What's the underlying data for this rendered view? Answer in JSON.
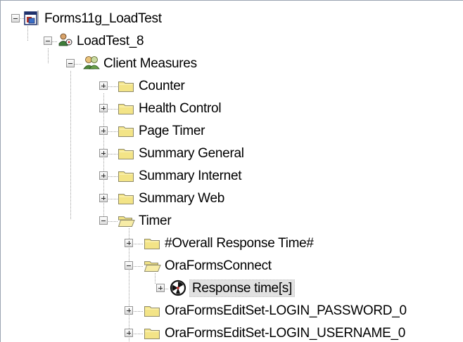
{
  "tree": {
    "items": [
      {
        "label": "Forms11g_LoadTest",
        "icon": "loadtest-project-icon",
        "expanded": true
      },
      {
        "label": "LoadTest_8",
        "icon": "loadtest-run-icon",
        "expanded": true
      },
      {
        "label": "Client Measures",
        "icon": "client-measures-icon",
        "expanded": true
      },
      {
        "label": "Counter",
        "icon": "folder-icon",
        "expanded": false
      },
      {
        "label": "Health Control",
        "icon": "folder-icon",
        "expanded": false
      },
      {
        "label": "Page Timer",
        "icon": "folder-icon",
        "expanded": false
      },
      {
        "label": "Summary General",
        "icon": "folder-icon",
        "expanded": false
      },
      {
        "label": "Summary Internet",
        "icon": "folder-icon",
        "expanded": false
      },
      {
        "label": "Summary Web",
        "icon": "folder-icon",
        "expanded": false
      },
      {
        "label": "Timer",
        "icon": "open-folder-icon",
        "expanded": true
      },
      {
        "label": "#Overall Response Time#",
        "icon": "folder-icon",
        "expanded": false
      },
      {
        "label": "OraFormsConnect",
        "icon": "open-folder-icon",
        "expanded": true
      },
      {
        "label": "Response time[s]",
        "icon": "timer-measure-icon",
        "expanded": false,
        "selected": true
      },
      {
        "label": "OraFormsEditSet-LOGIN_PASSWORD_0",
        "icon": "folder-icon",
        "expanded": false
      },
      {
        "label": "OraFormsEditSet-LOGIN_USERNAME_0",
        "icon": "folder-icon",
        "expanded": false
      }
    ]
  },
  "colors": {
    "folder": "#f3e487",
    "folder_border": "#8e8a6a",
    "selection": "#e1e1e1",
    "guide_line": "#a0a0a0",
    "panel_border": "#9aa4b1"
  }
}
